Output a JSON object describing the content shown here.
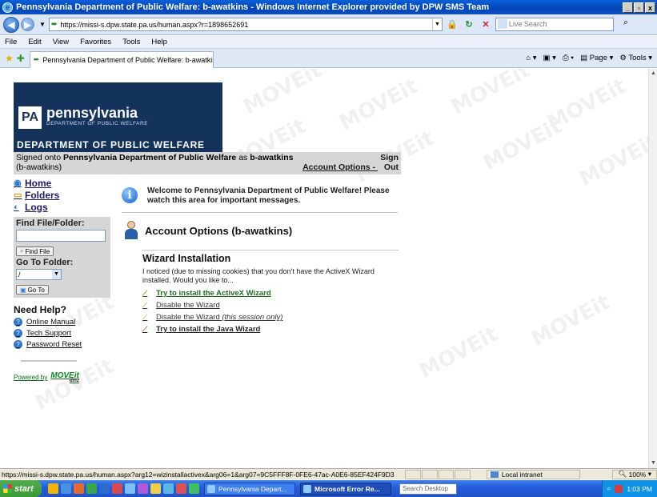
{
  "window": {
    "title": "Pennsylvania Department of Public Welfare: b-awatkins - Windows Internet Explorer provided by DPW SMS Team",
    "min_label": "_",
    "max_label": "▫",
    "close_label": "x"
  },
  "addressbar": {
    "url": "https://missi-s.dpw.state.pa.us/human.aspx?r=1898652691",
    "search_placeholder": "Live Search"
  },
  "menu": {
    "items": [
      "File",
      "Edit",
      "View",
      "Favorites",
      "Tools",
      "Help"
    ]
  },
  "tab": {
    "label": "Pennsylvania Department of Public Welfare: b-awatkins",
    "cmd_page": "Page",
    "cmd_tools": "Tools"
  },
  "banner": {
    "pa_abbr": "PA",
    "name": "pennsylvania",
    "subtitle": "DEPARTMENT OF PUBLIC WELFARE",
    "dept": "DEPARTMENT OF PUBLIC WELFARE"
  },
  "signin": {
    "prefix": "Signed onto",
    "org": "Pennsylvania Department of Public Welfare",
    "as": "as",
    "user": "b-awatkins",
    "user_paren": "(b-awatkins)",
    "account_options": "Account Options",
    "dash": "-",
    "sign_out": "Sign Out"
  },
  "leftnav": {
    "home": "Home",
    "folders": "Folders",
    "logs": "Logs",
    "find_title": "Find File/Folder:",
    "find_button": "Find File",
    "goto_title": "Go To Folder:",
    "goto_value": "/",
    "goto_button": "Go To",
    "help_title": "Need Help?",
    "help_links": [
      "Online Manual",
      "Tech Support",
      "Password Reset"
    ],
    "powered_by": "Powered by",
    "move_logo": "MOVEit",
    "move_sub": "dmz"
  },
  "main": {
    "welcome": "Welcome to Pennsylvania Department of Public Welfare! Please watch this area for important messages.",
    "account_title": "Account Options (b-awatkins)",
    "wizard_title": "Wizard Installation",
    "wizard_text": "I noticed (due to missing cookies) that you don't have the ActiveX Wizard installed. Would you like to...",
    "link_install_activex": "Try to install the ActiveX Wizard",
    "link_disable": "Disable the Wizard",
    "link_disable_session_prefix": "Disable the Wizard ",
    "link_disable_session_suffix": "(this session only)",
    "link_install_java": "Try to install the Java Wizard"
  },
  "watermark": "MOVEit",
  "statusbar": {
    "url": "https://missi-s.dpw.state.pa.us/human.aspx?arg12=wizinstallactivex&arg06=1&arg07=9C5FFF8F-0FE6-47ac-A0E6-85EF424F9D3",
    "zone": "Local intranet",
    "zoom": "100%"
  },
  "taskbar": {
    "start": "start",
    "items": [
      "Pennsylvania Depart...",
      "Microsoft Error Re..."
    ],
    "search_placeholder": "Search Desktop",
    "time": "1:03 PM"
  },
  "colors": {
    "banner": "#14335c",
    "panel": "#d6d6d6",
    "link_green": "#1b6e1b",
    "titlebar": "#0446b8"
  }
}
